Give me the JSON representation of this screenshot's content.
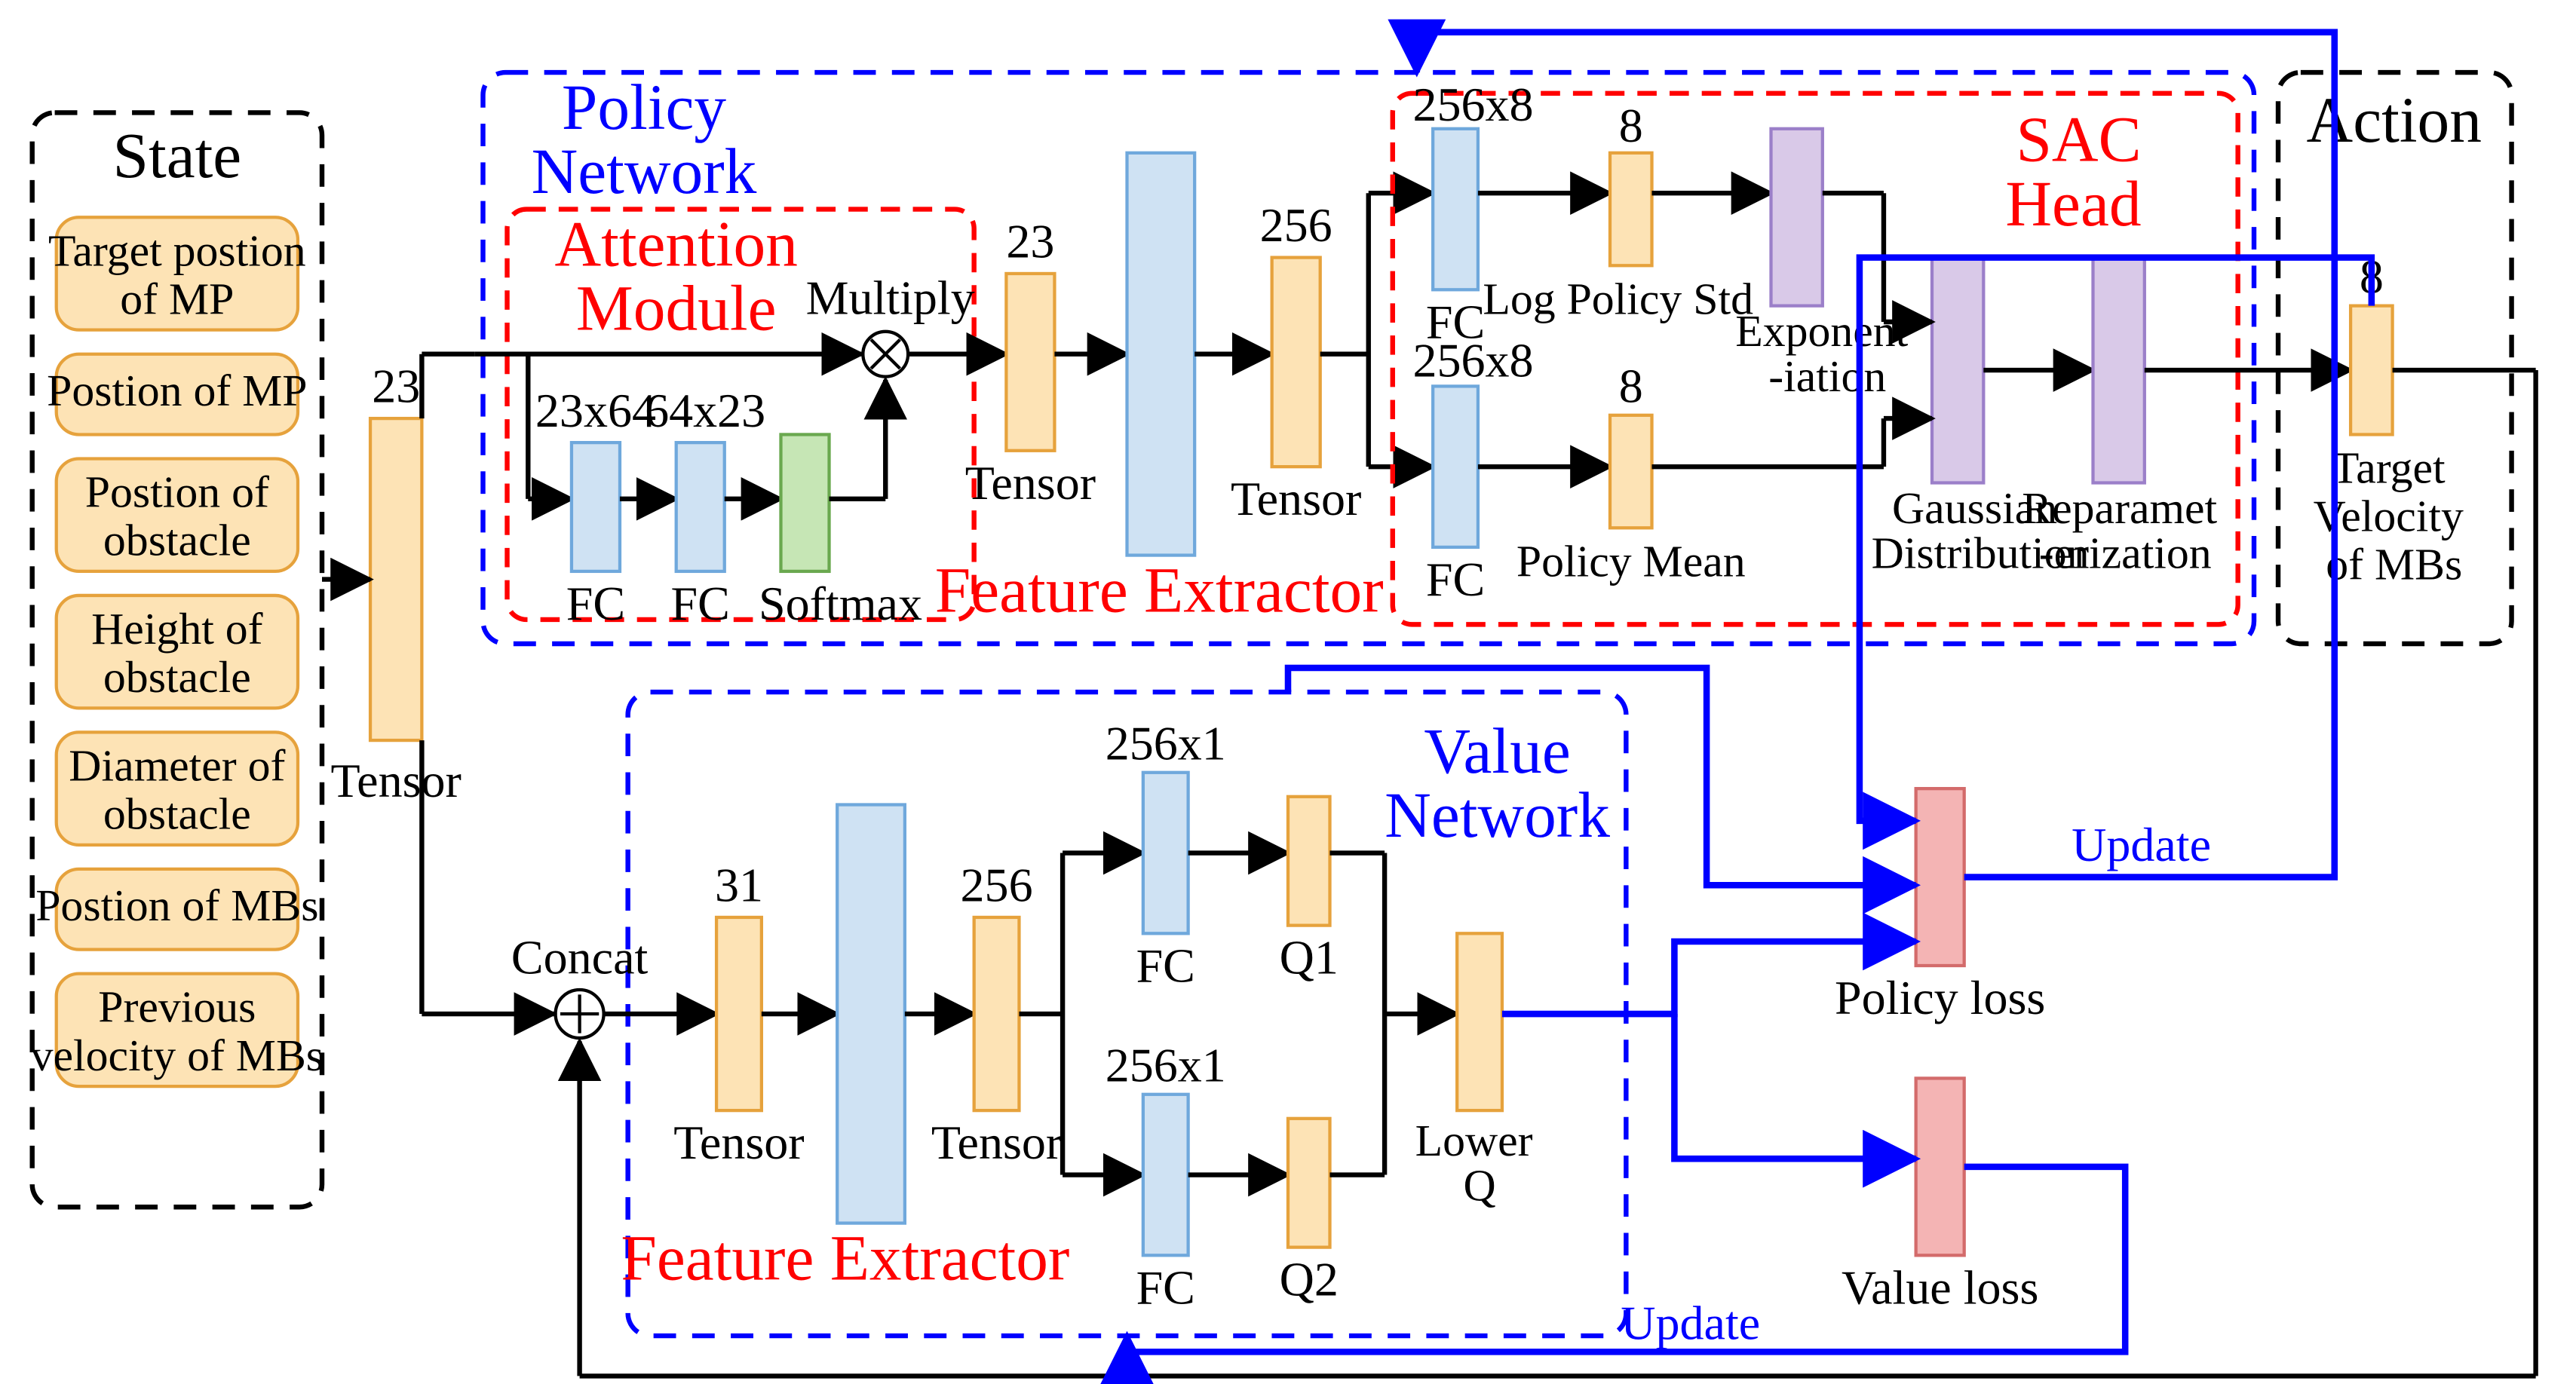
{
  "state": {
    "title": "State",
    "items": [
      "Target postion of MP",
      "Postion of MP",
      "Postion of obstacle",
      "Height of obstacle",
      "Diameter of obstacle",
      "Postion of MBs",
      "Previous velocity of MBs"
    ],
    "tensor_dim": "23",
    "tensor_label": "Tensor"
  },
  "policy": {
    "title1": "Policy",
    "title2": "Network",
    "attention": {
      "title1": "Attention",
      "title2": "Module",
      "fc1_dim": "23x64",
      "fc1_label": "FC",
      "fc2_dim": "64x23",
      "fc2_label": "FC",
      "softmax_label": "Softmax",
      "multiply_label": "Multiply"
    },
    "after_attn": {
      "tensor1_dim": "23",
      "tensor1_label": "Tensor",
      "fe_label": "Feature Extractor",
      "tensor2_dim": "256",
      "tensor2_label": "Tensor"
    },
    "sac": {
      "title1": "SAC",
      "title2": "Head",
      "fc_up_dim": "256x8",
      "fc_up_label": "FC",
      "logstd_dim": "8",
      "logstd_label": "Log Policy Std",
      "exp_label1": "Exponent",
      "exp_label2": "-iation",
      "fc_dn_dim": "256x8",
      "fc_dn_label": "FC",
      "mean_dim": "8",
      "mean_label": "Policy Mean",
      "gauss_label1": "Gaussian",
      "gauss_label2": "Distribution",
      "reparam_label1": "Reparamet",
      "reparam_label2": "-erization"
    }
  },
  "action": {
    "title": "Action",
    "dim": "8",
    "label1": "Target",
    "label2": "Velocity",
    "label3": "of MBs"
  },
  "value": {
    "title1": "Value",
    "title2": "Network",
    "concat_label": "Concat",
    "tensor1_dim": "31",
    "tensor1_label": "Tensor",
    "fe_label": "Feature Extractor",
    "tensor2_dim": "256",
    "tensor2_label": "Tensor",
    "fc_up_dim": "256x1",
    "fc_up_label": "FC",
    "q1_label": "Q1",
    "fc_dn_dim": "256x1",
    "fc_dn_label": "FC",
    "q2_label": "Q2",
    "lowerq_label1": "Lower",
    "lowerq_label2": "Q"
  },
  "losses": {
    "policy_loss": "Policy loss",
    "value_loss": "Value loss",
    "update": "Update"
  }
}
